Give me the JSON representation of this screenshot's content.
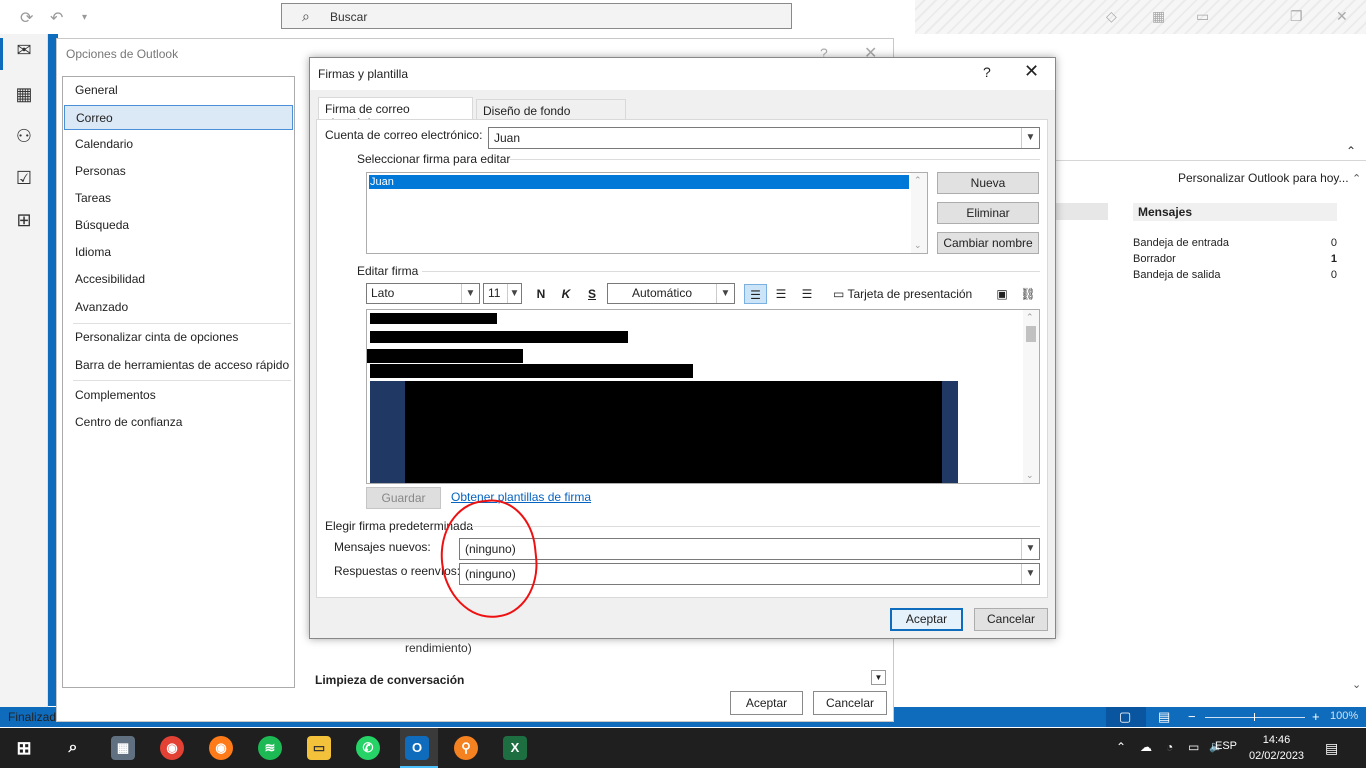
{
  "search": {
    "placeholder": "Buscar"
  },
  "options_dialog": {
    "title": "Opciones de Outlook",
    "nav": [
      "General",
      "Correo",
      "Calendario",
      "Personas",
      "Tareas",
      "Búsqueda",
      "Idioma",
      "Accesibilidad",
      "Avanzado",
      "Personalizar cinta de opciones",
      "Barra de herramientas de acceso rápido",
      "Complementos",
      "Centro de confianza"
    ],
    "selected": "Correo",
    "body_text": "rendimiento)",
    "section": "Limpieza de conversación",
    "ok": "Aceptar",
    "cancel": "Cancelar"
  },
  "right_pane": {
    "customize": "Personalizar Outlook para hoy...",
    "messages_title": "Mensajes",
    "rows": [
      {
        "label": "Bandeja de entrada",
        "value": "0"
      },
      {
        "label": "Borrador",
        "value": "1"
      },
      {
        "label": "Bandeja de salida",
        "value": "0"
      }
    ]
  },
  "status": {
    "label": "Finalizad",
    "zoom": "100%"
  },
  "sig_dialog": {
    "title": "Firmas y plantilla",
    "help": "?",
    "tabs": [
      "Firma de correo electrónico",
      "Diseño de fondo personal"
    ],
    "account_label": "Cuenta de correo electrónico:",
    "account_value": "Juan",
    "select_label": "Seleccionar firma para editar",
    "signatures": [
      "Juan"
    ],
    "buttons": {
      "new": "Nueva",
      "delete": "Eliminar",
      "rename": "Cambiar nombre"
    },
    "edit_label": "Editar firma",
    "font": "Lato",
    "size": "11",
    "bold": "N",
    "italic": "K",
    "underline": "S",
    "color": "Automático",
    "business_card": "Tarjeta de presentación",
    "save": "Guardar",
    "get_templates": "Obtener plantillas de firma",
    "default_label": "Elegir firma predeterminada",
    "new_msgs_label": "Mensajes nuevos:",
    "new_msgs_value": "(ninguno)",
    "replies_label": "Respuestas o reenvíos:",
    "replies_value": "(ninguno)",
    "ok": "Aceptar",
    "cancel": "Cancelar"
  },
  "taskbar": {
    "lang": "ESP",
    "time": "14:46",
    "date": "02/02/2023"
  }
}
